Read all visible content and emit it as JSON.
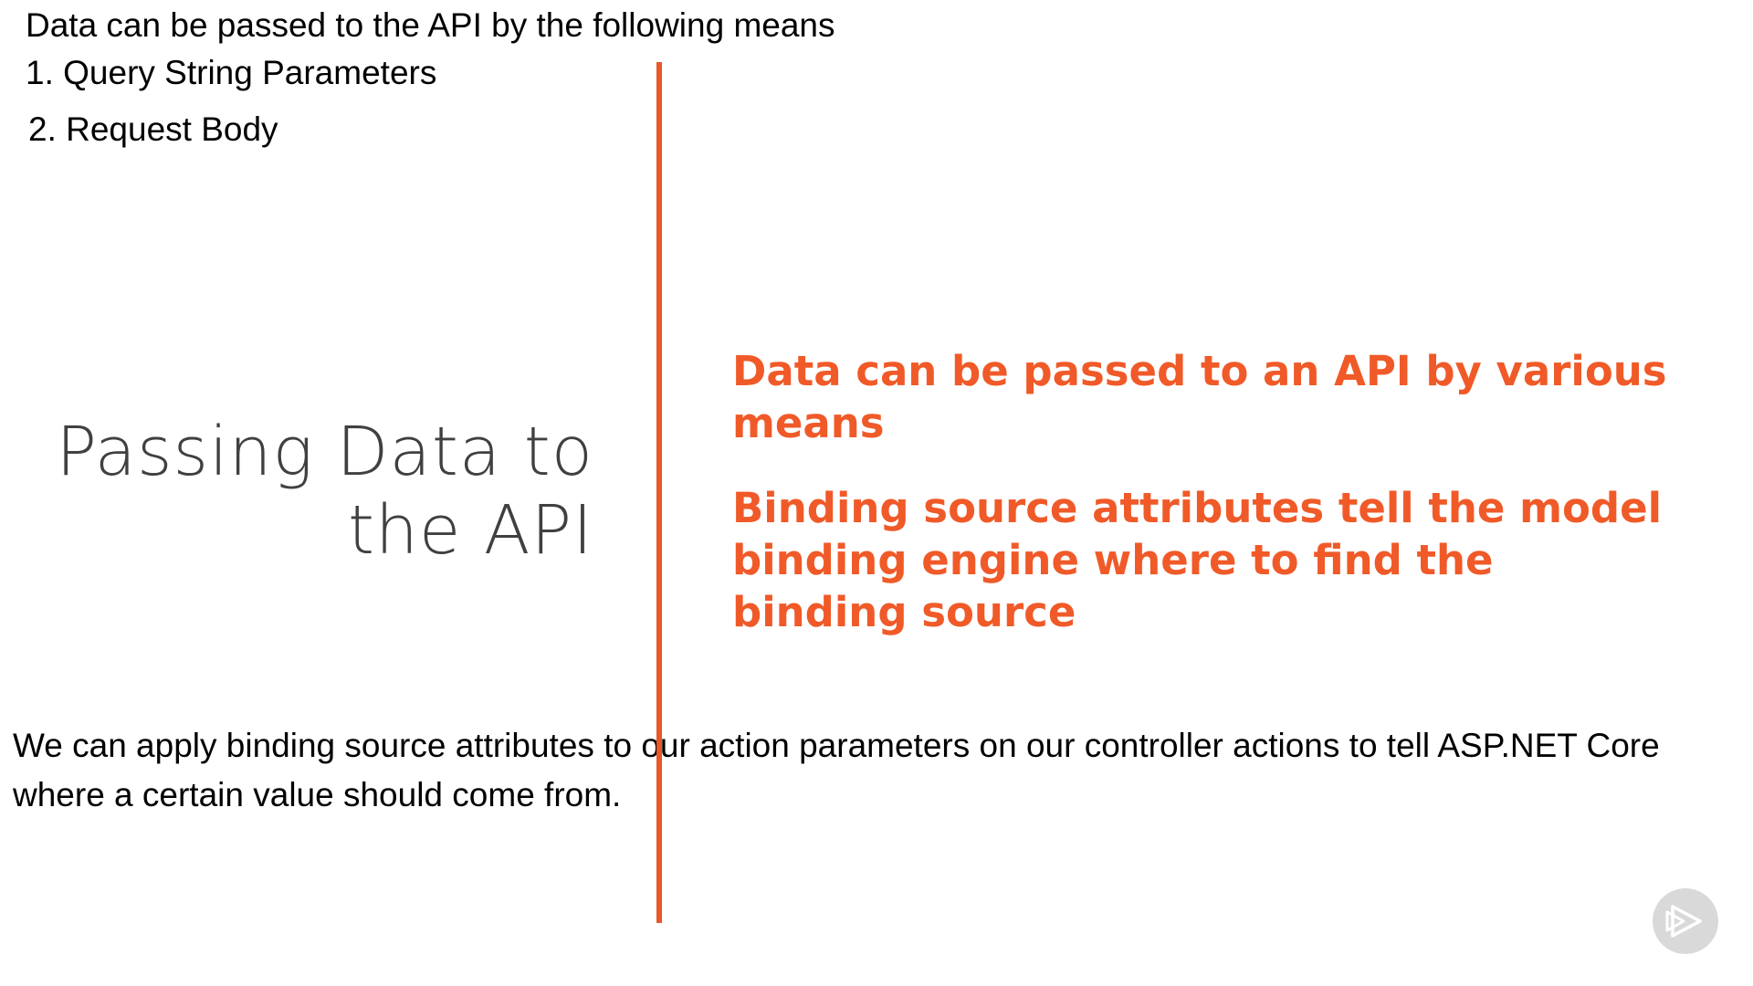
{
  "notes": {
    "top": "Data can be passed to the API by the following means",
    "items": [
      "1. Query String Parameters",
      "2. Request Body"
    ],
    "bottom": "We can apply binding source attributes to our action parameters on our controller actions to tell ASP.NET Core where a certain value should come from."
  },
  "slide": {
    "title_line1": "Passing Data to",
    "title_line2": "the API",
    "points": [
      "Data can be passed to an API by various means",
      "Binding source attributes tell the model binding engine where to find the binding source"
    ]
  },
  "badge": {
    "icon": "play-logo-icon"
  },
  "colors": {
    "accent": "#f05a28",
    "title": "#404040",
    "badge": "#d9d9d9"
  }
}
